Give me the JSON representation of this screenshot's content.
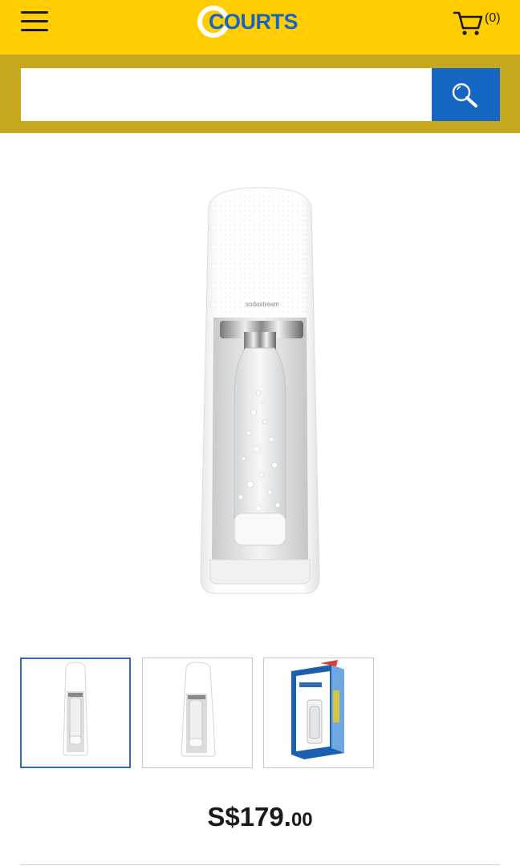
{
  "header": {
    "logo_text": "COURTS",
    "cart_count": "(0)",
    "brand_yellow": "#ffcd00",
    "brand_blue": "#1566c0"
  },
  "search": {
    "placeholder": "",
    "value": "",
    "band_color": "#c6a81f"
  },
  "product": {
    "brand_print": "sodastream",
    "thumbnails": [
      {
        "name": "front-view",
        "active": true
      },
      {
        "name": "side-view",
        "active": false
      },
      {
        "name": "box-view",
        "active": false
      }
    ],
    "price_main": "S$179.",
    "price_cents": "00"
  },
  "icons": {
    "menu": "hamburger-icon",
    "cart": "cart-icon",
    "search": "magnifier-icon"
  }
}
